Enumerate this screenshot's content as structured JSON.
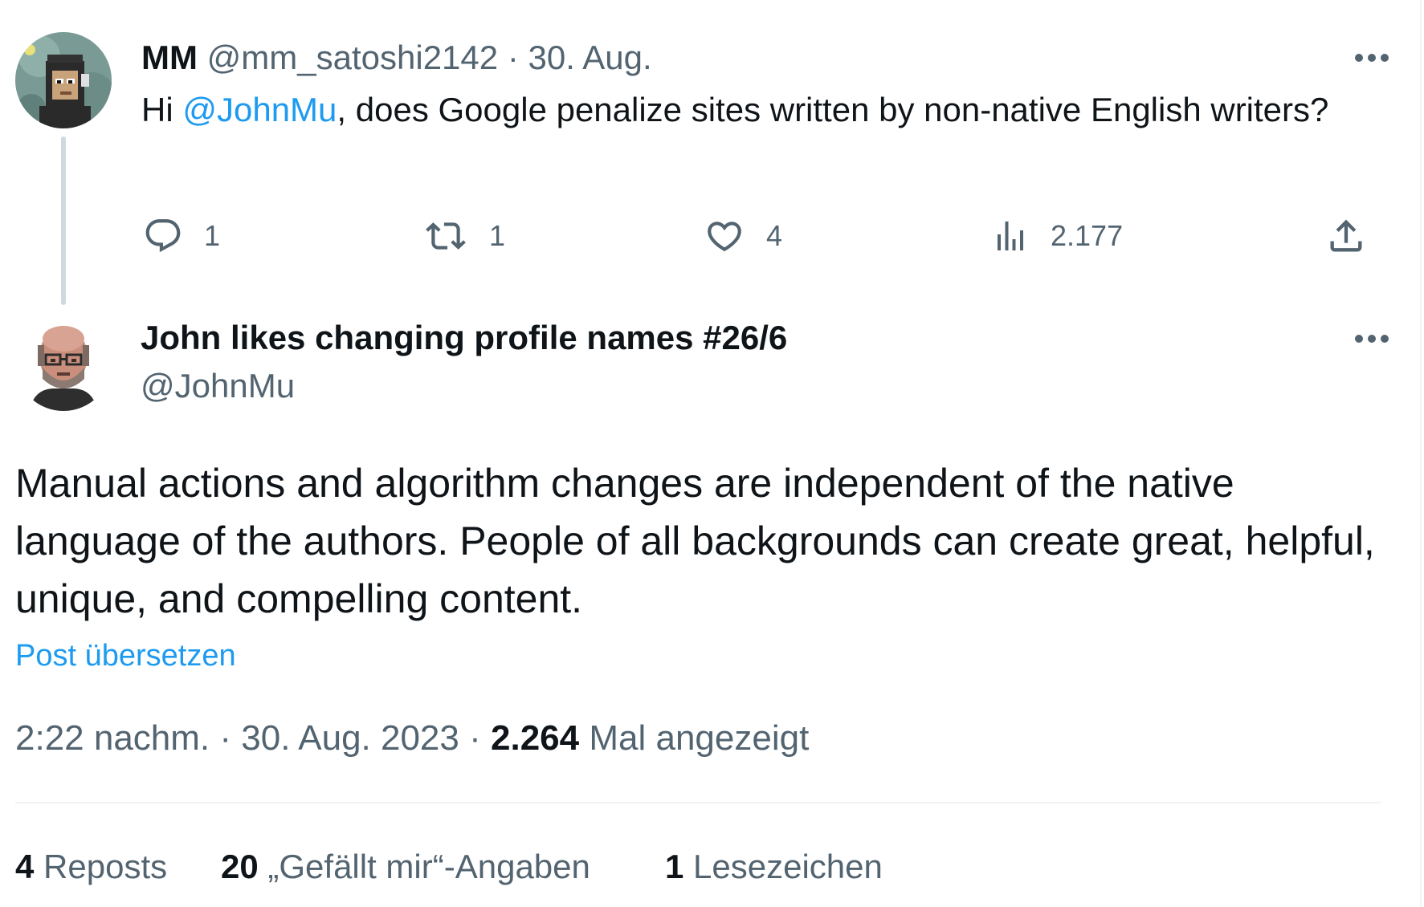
{
  "parent_tweet": {
    "display_name": "MM",
    "handle": "@mm_satoshi2142",
    "separator": "·",
    "date": "30. Aug.",
    "text_prefix": "Hi ",
    "mention": "@JohnMu",
    "text_suffix": ", does Google penalize sites written by non-native English writers?",
    "actions": {
      "replies": "1",
      "reposts": "1",
      "likes": "4",
      "views": "2.177"
    }
  },
  "reply_tweet": {
    "display_name": "John likes changing profile names #26/6",
    "handle": "@JohnMu",
    "text": "Manual actions and algorithm changes are independent of the native language of the authors. People of all backgrounds can create great, helpful, unique, and compelling content.",
    "translate_label": "Post übersetzen",
    "time": "2:22 nachm.",
    "separator": "·",
    "date": "30. Aug. 2023",
    "view_count": "2.264",
    "view_label": "Mal angezeigt",
    "stats": {
      "reposts_count": "4",
      "reposts_label": "Reposts",
      "likes_count": "20",
      "likes_label": "„Gefällt mir“-Angaben",
      "bookmarks_count": "1",
      "bookmarks_label": "Lesezeichen"
    }
  },
  "icons": {
    "reply": "reply-icon",
    "repost": "repost-icon",
    "like": "heart-icon",
    "views": "analytics-icon",
    "share": "share-icon",
    "more": "more-icon"
  },
  "colors": {
    "text": "#0f1419",
    "muted": "#536471",
    "link": "#1d9bf0",
    "thread_line": "#cfd9de",
    "divider": "#eff3f4"
  }
}
